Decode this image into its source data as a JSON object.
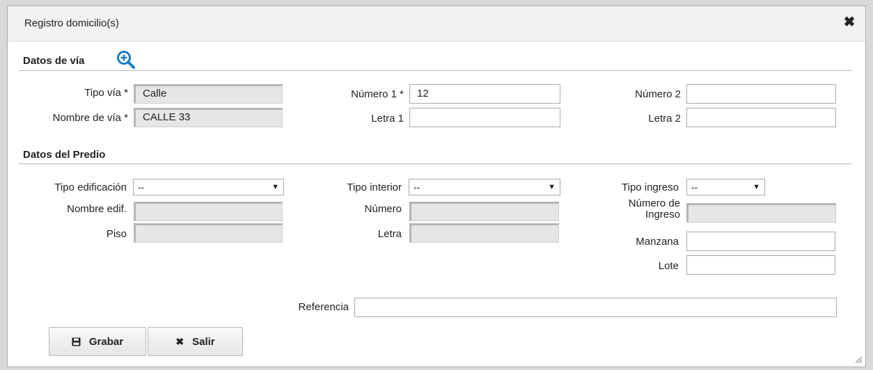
{
  "dialog": {
    "title": "Registro domicilio(s)",
    "close_glyph": "✖"
  },
  "via": {
    "section_title": "Datos de vía",
    "zoom_icon": "zoom-in-icon",
    "tipo_via_label": "Tipo vía *",
    "tipo_via_value": "Calle",
    "nombre_via_label": "Nombre de vía *",
    "nombre_via_value": "CALLE 33",
    "numero1_label": "Número 1 *",
    "numero1_value": "12",
    "letra1_label": "Letra 1",
    "letra1_value": "",
    "numero2_label": "Número 2",
    "numero2_value": "",
    "letra2_label": "Letra 2",
    "letra2_value": ""
  },
  "predio": {
    "section_title": "Datos del Predio",
    "tipo_edificacion_label": "Tipo edificación",
    "tipo_edificacion_value": "--",
    "nombre_edif_label": "Nombre edif.",
    "piso_label": "Piso",
    "tipo_interior_label": "Tipo interior",
    "tipo_interior_value": "--",
    "numero_label": "Número",
    "letra_label": "Letra",
    "tipo_ingreso_label": "Tipo ingreso",
    "tipo_ingreso_value": "--",
    "numero_ingreso_label": "Número de Ingreso",
    "manzana_label": "Manzana",
    "lote_label": "Lote",
    "referencia_label": "Referencia",
    "referencia_value": ""
  },
  "buttons": {
    "grabar_label": "Grabar",
    "grabar_icon": "save-icon",
    "salir_label": "Salir",
    "salir_icon": "close-icon"
  },
  "colors": {
    "accent": "#1a7dc4",
    "titlebar": "#f2f2f2"
  }
}
